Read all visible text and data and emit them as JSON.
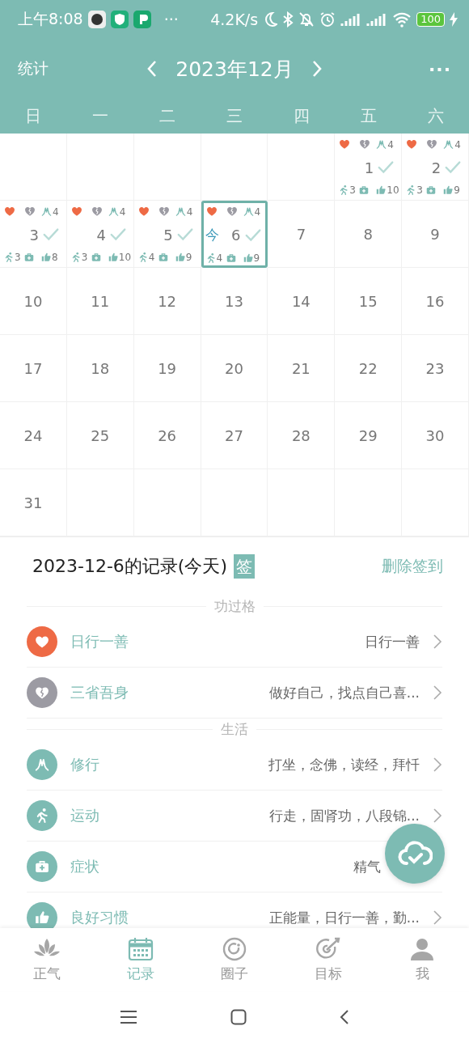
{
  "status_bar": {
    "time": "上午8:08",
    "more": "···",
    "speed": "4.2K/s",
    "battery": "100"
  },
  "header": {
    "left": "统计",
    "month": "2023年12月",
    "menu": "···"
  },
  "weekdays": [
    "日",
    "一",
    "二",
    "三",
    "四",
    "五",
    "六"
  ],
  "weeks": [
    [
      {
        "kind": "blank"
      },
      {
        "kind": "blank"
      },
      {
        "kind": "blank"
      },
      {
        "kind": "blank"
      },
      {
        "kind": "blank"
      },
      {
        "kind": "day",
        "day": "1",
        "today": false,
        "record": {
          "practice": "4",
          "exercise": "3",
          "habits": "10",
          "checked_in": true
        }
      },
      {
        "kind": "day",
        "day": "2",
        "today": false,
        "record": {
          "practice": "4",
          "exercise": "3",
          "habits": "9",
          "checked_in": true
        }
      }
    ],
    [
      {
        "kind": "day",
        "day": "3",
        "today": false,
        "record": {
          "practice": "4",
          "exercise": "3",
          "habits": "8",
          "checked_in": true
        }
      },
      {
        "kind": "day",
        "day": "4",
        "today": false,
        "record": {
          "practice": "4",
          "exercise": "3",
          "habits": "10",
          "checked_in": true
        }
      },
      {
        "kind": "day",
        "day": "5",
        "today": false,
        "record": {
          "practice": "4",
          "exercise": "4",
          "habits": "9",
          "checked_in": true
        }
      },
      {
        "kind": "day",
        "day": "6",
        "today": true,
        "today_label": "今",
        "record": {
          "practice": "4",
          "exercise": "4",
          "habits": "9",
          "checked_in": true
        }
      },
      {
        "kind": "day",
        "day": "7",
        "today": false
      },
      {
        "kind": "day",
        "day": "8",
        "today": false
      },
      {
        "kind": "day",
        "day": "9",
        "today": false
      }
    ],
    [
      {
        "kind": "day",
        "day": "10",
        "today": false
      },
      {
        "kind": "day",
        "day": "11",
        "today": false
      },
      {
        "kind": "day",
        "day": "12",
        "today": false
      },
      {
        "kind": "day",
        "day": "13",
        "today": false
      },
      {
        "kind": "day",
        "day": "14",
        "today": false
      },
      {
        "kind": "day",
        "day": "15",
        "today": false
      },
      {
        "kind": "day",
        "day": "16",
        "today": false
      }
    ],
    [
      {
        "kind": "day",
        "day": "17",
        "today": false
      },
      {
        "kind": "day",
        "day": "18",
        "today": false
      },
      {
        "kind": "day",
        "day": "19",
        "today": false
      },
      {
        "kind": "day",
        "day": "20",
        "today": false
      },
      {
        "kind": "day",
        "day": "21",
        "today": false
      },
      {
        "kind": "day",
        "day": "22",
        "today": false
      },
      {
        "kind": "day",
        "day": "23",
        "today": false
      }
    ],
    [
      {
        "kind": "day",
        "day": "24",
        "today": false
      },
      {
        "kind": "day",
        "day": "25",
        "today": false
      },
      {
        "kind": "day",
        "day": "26",
        "today": false
      },
      {
        "kind": "day",
        "day": "27",
        "today": false
      },
      {
        "kind": "day",
        "day": "28",
        "today": false
      },
      {
        "kind": "day",
        "day": "29",
        "today": false
      },
      {
        "kind": "day",
        "day": "30",
        "today": false
      }
    ],
    [
      {
        "kind": "day",
        "day": "31",
        "today": false
      },
      {
        "kind": "blank"
      },
      {
        "kind": "blank"
      },
      {
        "kind": "blank"
      },
      {
        "kind": "blank"
      },
      {
        "kind": "blank"
      },
      {
        "kind": "blank"
      }
    ]
  ],
  "record": {
    "title": "2023-12-6的记录(今天)",
    "badge": "签",
    "action": "删除签到",
    "sections": [
      {
        "title": "功过格",
        "items": [
          {
            "kind": "heart",
            "color": "#ee6a45",
            "label": "日行一善",
            "value": "日行一善",
            "chevron": true
          },
          {
            "kind": "broken-heart",
            "color": "#9c9ba3",
            "label": "三省吾身",
            "value": "做好自己，找点自己喜...",
            "chevron": true
          }
        ]
      },
      {
        "title": "生活",
        "items": [
          {
            "kind": "hands",
            "color": "#7dbbb3",
            "label": "修行",
            "value": "打坐，念佛，读经，拜忏",
            "chevron": true
          },
          {
            "kind": "runner",
            "color": "#7dbbb3",
            "label": "运动",
            "value": "行走，固肾功，八段锦...",
            "chevron": true
          },
          {
            "kind": "medkit",
            "color": "#7dbbb3",
            "label": "症状",
            "value": "精气",
            "chevron": false
          },
          {
            "kind": "thumbs-up",
            "color": "#7dbbb3",
            "label": "良好习惯",
            "value": "正能量，日行一善，勤...",
            "chevron": true
          }
        ]
      }
    ]
  },
  "tabs": [
    {
      "kind": "lotus",
      "label": "正气",
      "selected": false
    },
    {
      "kind": "calendar",
      "label": "记录",
      "selected": true
    },
    {
      "kind": "ring",
      "label": "圈子",
      "selected": false
    },
    {
      "kind": "target",
      "label": "目标",
      "selected": false
    },
    {
      "kind": "person",
      "label": "我",
      "selected": false
    }
  ]
}
